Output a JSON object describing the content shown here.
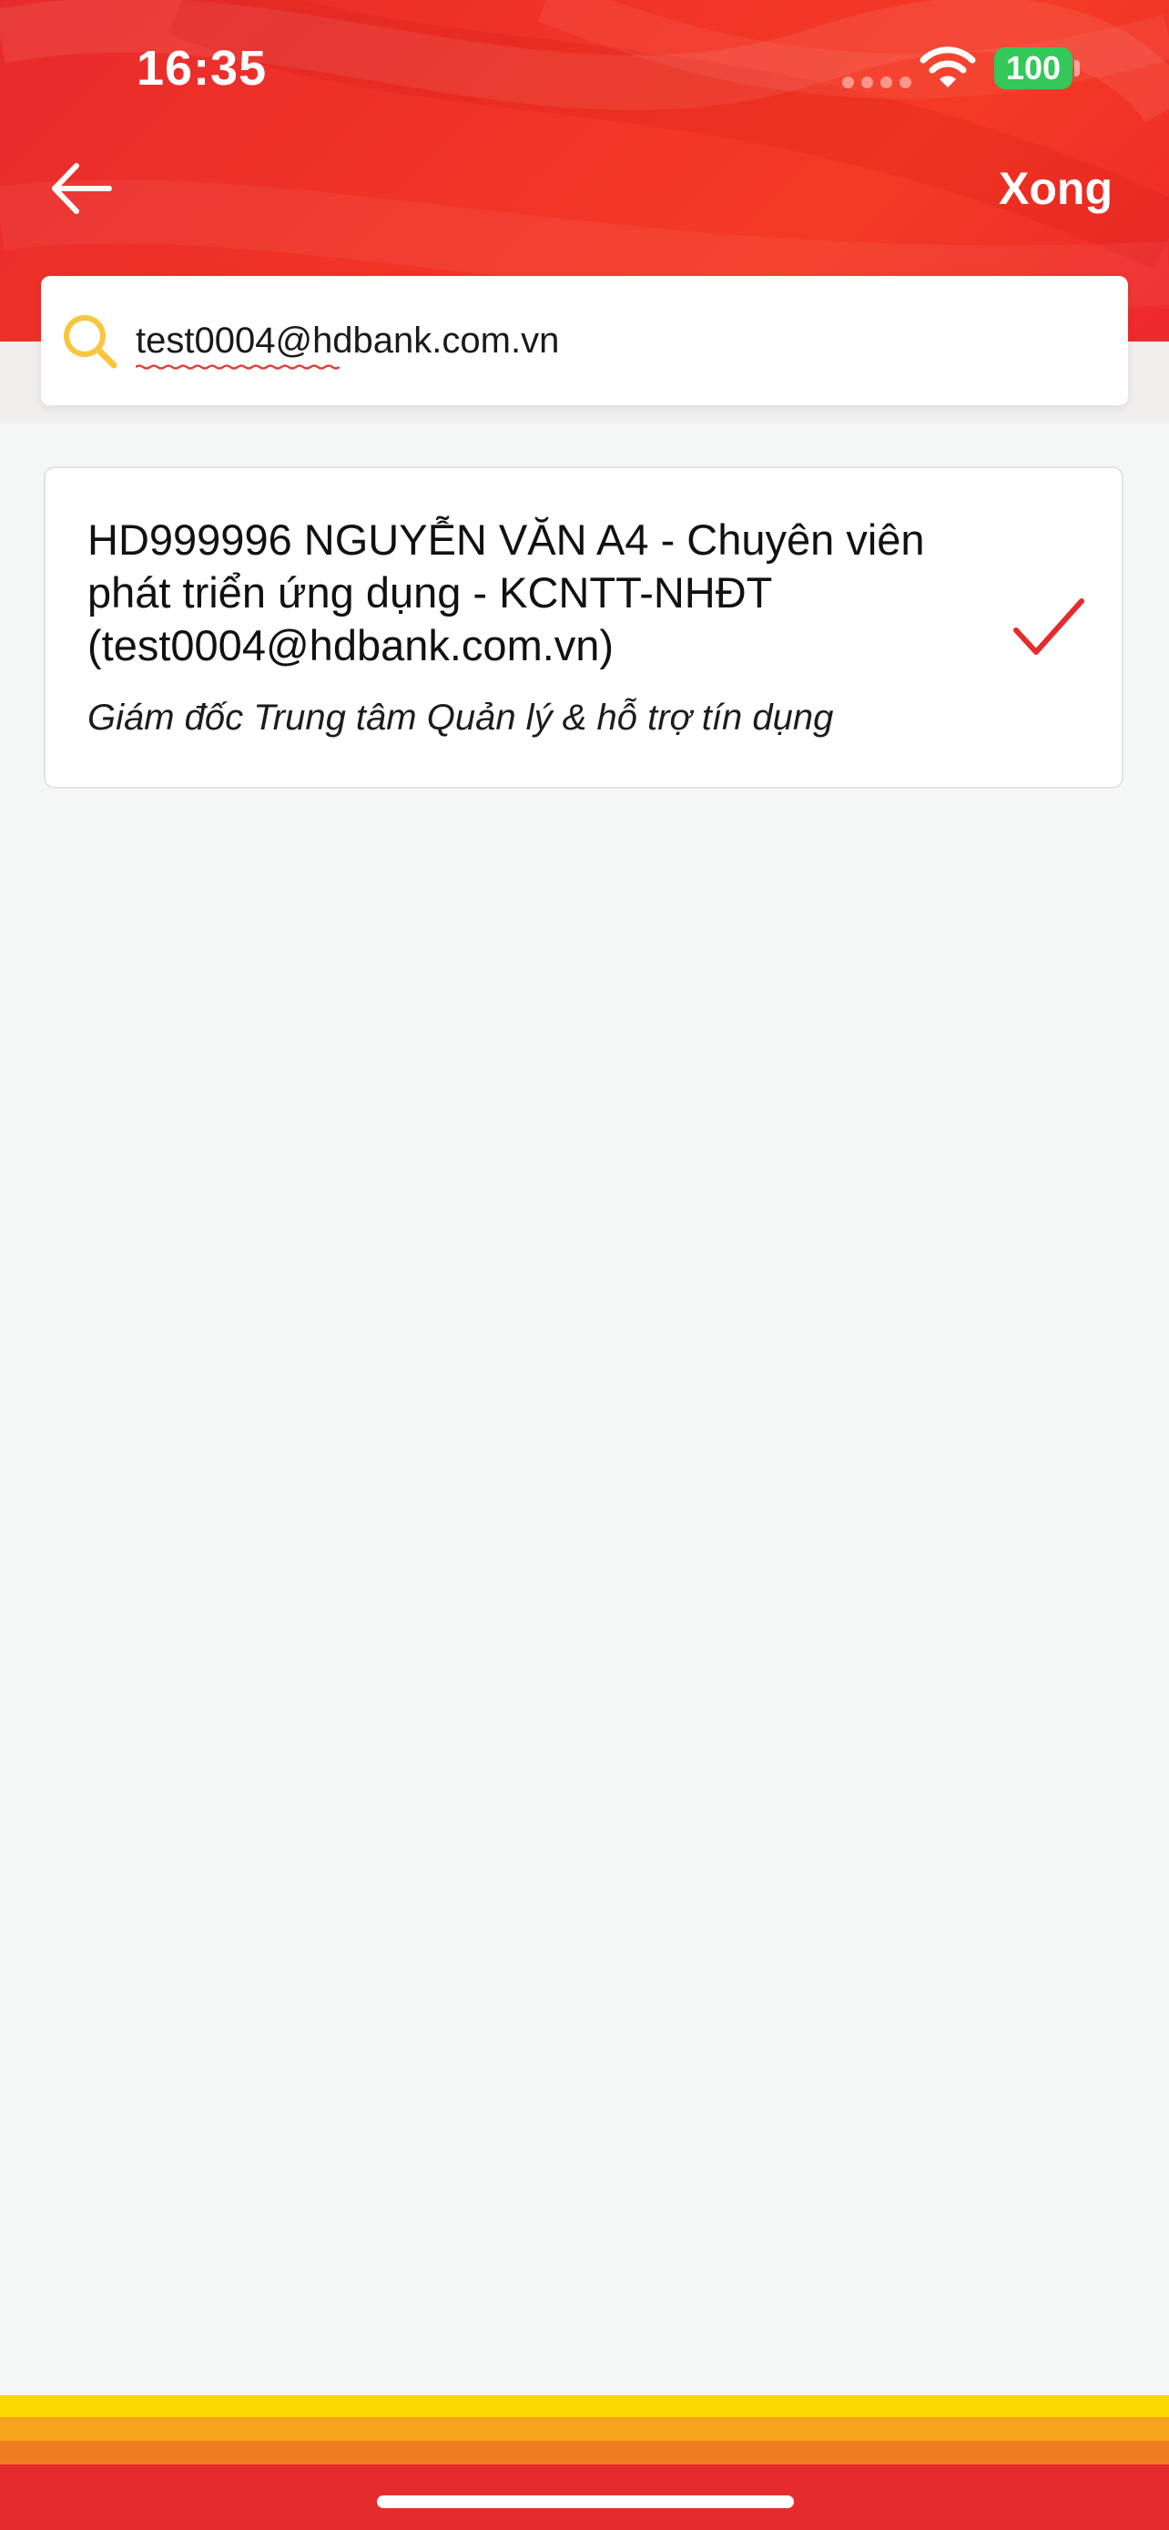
{
  "status_bar": {
    "time": "16:35",
    "battery": "100"
  },
  "header": {
    "back_icon": "arrow-left-icon",
    "done_label": "Xong"
  },
  "search": {
    "icon": "search-icon",
    "value": "test0004@hdbank.com.vn"
  },
  "results": [
    {
      "title": "HD999996 NGUYỄN VĂN A4 - Chuyên viên phát triển ứng dụng - KCNTT-NHĐT (test0004@hdbank.com.vn)",
      "subtitle": "Giám đốc Trung tâm Quản lý & hỗ trợ tín dụng",
      "selected": true
    }
  ],
  "colors": {
    "header_red": "#f23427",
    "check_red": "#e52b2d",
    "search_icon_yellow": "#f8c63d",
    "battery_green": "#34c759"
  }
}
